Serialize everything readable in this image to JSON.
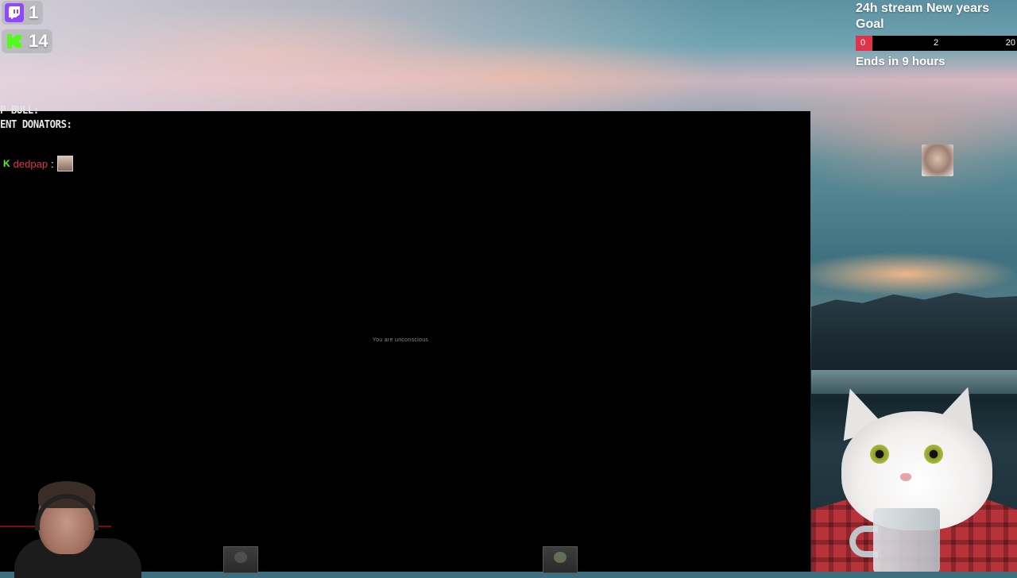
{
  "counters": {
    "twitch": {
      "icon": "twitch-icon",
      "value": "1"
    },
    "kick": {
      "icon": "kick-icon",
      "value": "14"
    }
  },
  "goal": {
    "title": "24h stream New years Goal",
    "current": "0",
    "mid": "2",
    "max": "20",
    "progress": 0,
    "ends": "Ends in 9 hours",
    "accent": "#e0324a"
  },
  "game": {
    "sys_line_1": "P BULL:",
    "sys_line_2": "ENT DONATORS:",
    "chat": {
      "platform_badge": "K",
      "user": "dedpap",
      "separator": ":"
    },
    "center_message": "You are unconscious"
  },
  "colors": {
    "kick_green": "#53fc18",
    "twitch_purple": "#9146ff",
    "chat_user": "#e0324a"
  }
}
